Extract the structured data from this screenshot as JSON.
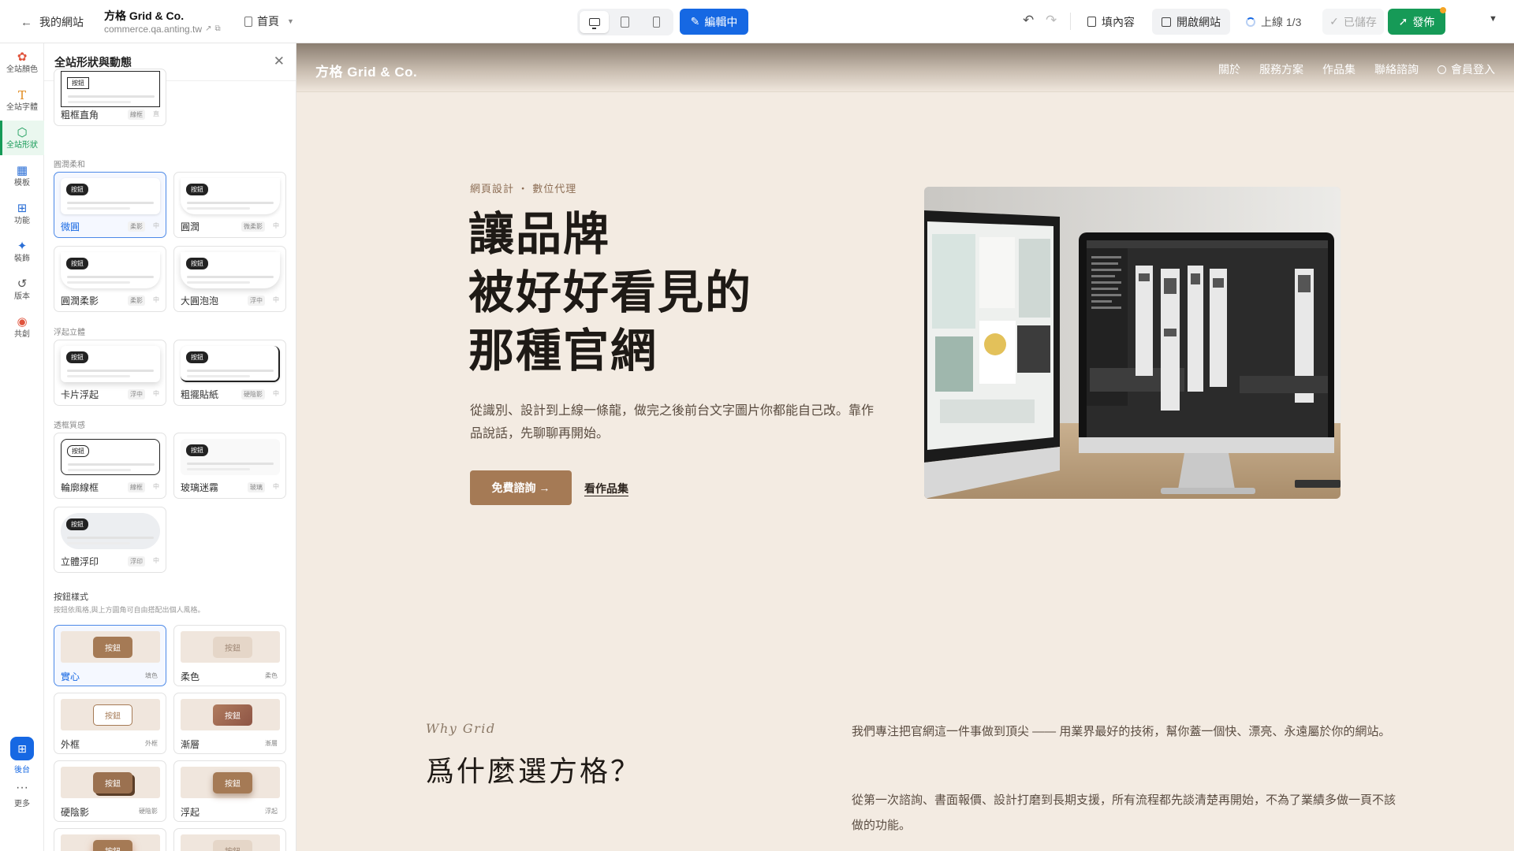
{
  "topbar": {
    "back_label": "我的網站",
    "site_name": "方格 Grid & Co.",
    "site_domain": "commerce.qa.anting.tw",
    "page_label": "首頁",
    "edit_label": "編輯中",
    "fill_label": "填內容",
    "open_label": "開啟網站",
    "status_label": "上線 1/3",
    "saved_label": "已儲存",
    "publish_label": "發佈"
  },
  "rail": {
    "items": [
      {
        "label": "全站顏色",
        "icon": "palette-icon"
      },
      {
        "label": "全站字體",
        "icon": "text-icon"
      },
      {
        "label": "全站形狀",
        "icon": "shapes-icon"
      },
      {
        "label": "模板",
        "icon": "template-icon"
      },
      {
        "label": "功能",
        "icon": "blocks-icon"
      },
      {
        "label": "裝飾",
        "icon": "sparkle-icon"
      },
      {
        "label": "版本",
        "icon": "history-icon"
      },
      {
        "label": "共創",
        "icon": "chat-icon"
      }
    ],
    "admin_label": "後台",
    "more_label": "更多"
  },
  "panel": {
    "title": "全站形狀與動態",
    "chip": "按鈕",
    "shapes": {
      "top_card": {
        "name": "粗框直角",
        "tag": "線框",
        "tag2": "直"
      },
      "sections": [
        {
          "label": "圓潤柔和",
          "cards": [
            {
              "name": "微圓",
              "tag": "柔影",
              "tag2": "中"
            },
            {
              "name": "圓潤",
              "tag": "微柔影",
              "tag2": "中"
            },
            {
              "name": "圓潤柔影",
              "tag": "柔影",
              "tag2": "中"
            },
            {
              "name": "大圓泡泡",
              "tag": "浮中",
              "tag2": "中"
            }
          ]
        },
        {
          "label": "浮起立體",
          "cards": [
            {
              "name": "卡片浮起",
              "tag": "浮中",
              "tag2": "中"
            },
            {
              "name": "粗擺貼紙",
              "tag": "硬陰影",
              "tag2": "中"
            }
          ]
        },
        {
          "label": "透框質感",
          "cards": [
            {
              "name": "輪廓線框",
              "tag": "線框",
              "tag2": "中"
            },
            {
              "name": "玻璃迷霧",
              "tag": "玻璃",
              "tag2": "中"
            },
            {
              "name": "立體浮印",
              "tag": "浮印",
              "tag2": "中"
            }
          ]
        }
      ]
    },
    "buttons": {
      "label": "按鈕樣式",
      "hint": "按鈕依風格,與上方圓角可自由搭配出個人風格。",
      "btn_text": "按鈕",
      "cards": [
        {
          "name": "實心",
          "tag": "填色"
        },
        {
          "name": "柔色",
          "tag": "柔色"
        },
        {
          "name": "外框",
          "tag": "外框"
        },
        {
          "name": "漸層",
          "tag": "漸層"
        },
        {
          "name": "硬陰影",
          "tag": "硬陰影"
        },
        {
          "name": "浮起",
          "tag": "浮起"
        }
      ]
    }
  },
  "site": {
    "logo": "方格 Grid & Co.",
    "nav": [
      "關於",
      "服務方案",
      "作品集",
      "聯絡諮詢"
    ],
    "login": "會員登入",
    "hero": {
      "eyebrow": "網頁設計 ・ 數位代理",
      "title_1": "讓品牌",
      "title_2": "被好好看見的",
      "title_3": "那種官網",
      "desc": "從識別、設計到上線一條龍，做完之後前台文字圖片你都能自己改。靠作品說話，先聊聊再開始。",
      "cta": "免費諮詢 →",
      "link": "看作品集"
    },
    "why": {
      "eyebrow": "Why Grid",
      "title": "爲什麼選方格？",
      "p1": "我們專注把官網這一件事做到頂尖 —— 用業界最好的技術，幫你蓋一個快、漂亮、永遠屬於你的網站。",
      "p2": "從第一次諮詢、書面報價、設計打磨到長期支援，所有流程都先談清楚再開始，不為了業績多做一頁不該做的功能。"
    }
  },
  "colors": {
    "accent": "#1668e3",
    "publish": "#169a57",
    "brand": "#a57a55",
    "canvas_bg": "#f3ebe2"
  }
}
